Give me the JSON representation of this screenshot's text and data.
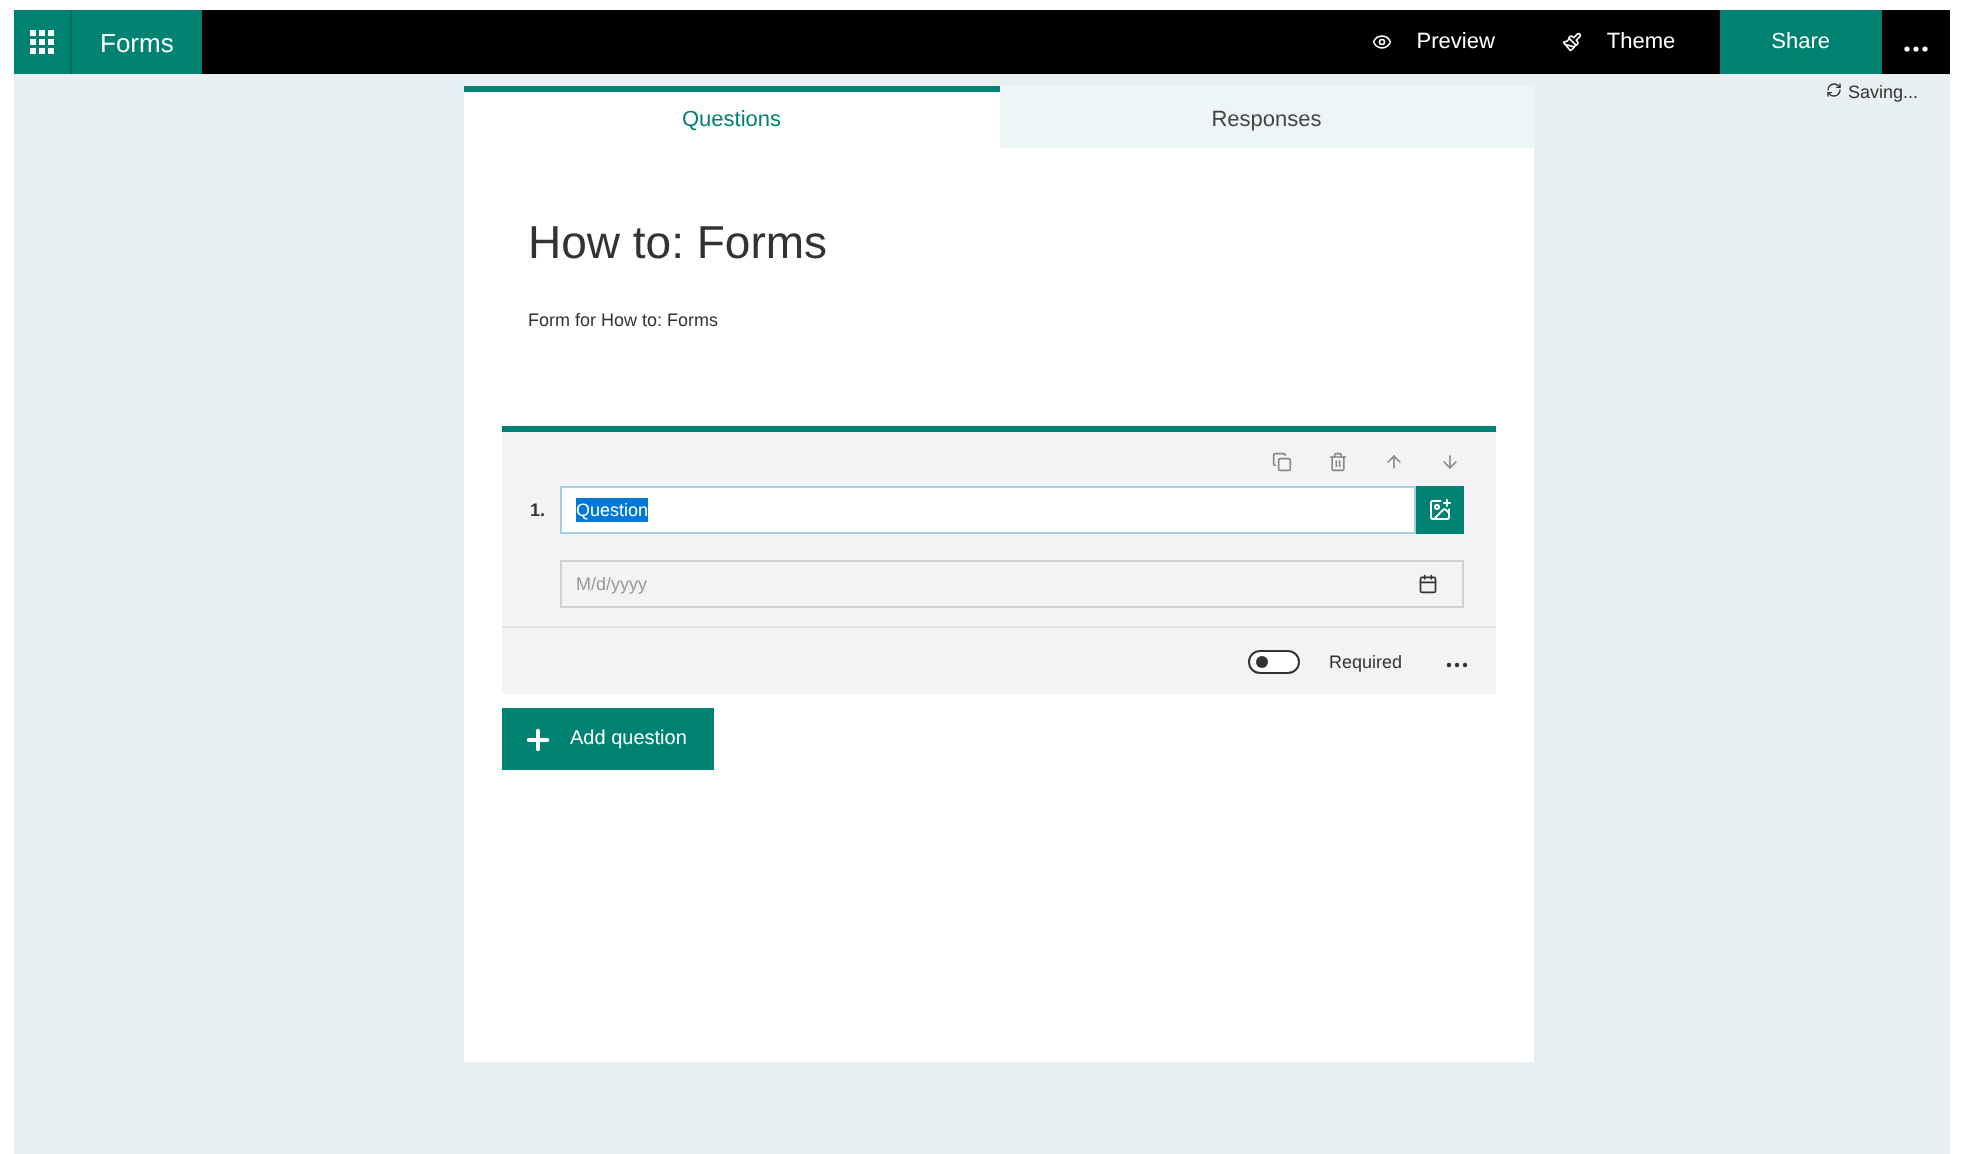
{
  "app_bar": {
    "app_name": "Forms",
    "actions": [
      {
        "kind": "preview",
        "label": "Preview"
      },
      {
        "kind": "theme",
        "label": "Theme"
      },
      {
        "kind": "share",
        "label": "Share"
      }
    ]
  },
  "tabs": [
    {
      "label": "Questions",
      "selected": true
    },
    {
      "label": "Responses",
      "selected": false
    }
  ],
  "status": "Saving...",
  "form": {
    "title": "How to: Forms",
    "description": "Form for How to: Forms"
  },
  "question": {
    "number": "1.",
    "title": "Question",
    "title_highlighted": true,
    "date_placeholder": "M/d/yyyy",
    "required": {
      "label": "Required",
      "on": false
    }
  },
  "add_button": "Add question"
}
